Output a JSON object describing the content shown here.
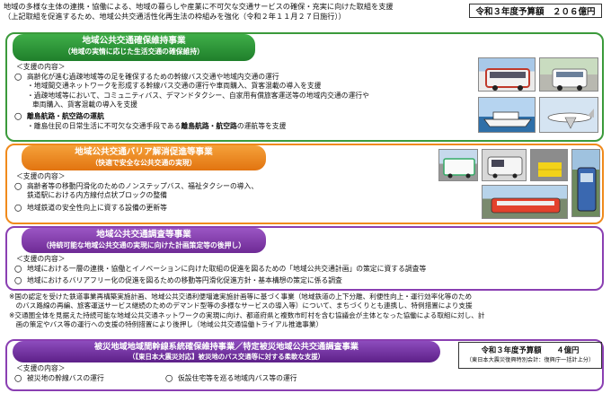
{
  "intro": [
    "地域の多様な主体の連携・協働による、地域の暮らしや産業に不可欠な交通サービスの確保・充実に向けた取組を支援",
    "（上記取組を促進するため、地域公共交通活性化再生法の枠組みを強化（令和２年１１月２７日施行））"
  ],
  "budget": "令和３年度予算額　２０６億円",
  "sections": {
    "s1": {
      "title": "地域公共交通確保維持事業",
      "subtitle": "（地域の実情に応じた生活交通の確保維持）",
      "support_label": "＜支援の内容＞",
      "bullet1": "高齢化が進む過疎地域等の足を確保するための幹線バス交通や地域内交通の運行",
      "sub1": "・地域間交通ネットワークを形成する幹線バス交通の運行や車両購入、貨客混載の導入を支援",
      "sub2": "・過疎地域等において、コミュニティバス、デマンドタクシー、自家用有償旅客運送等の地域内交通の運行や",
      "sub2b": "車両購入、貨客混載の導入を支援",
      "bullet2": "離島航路・航空路の運航",
      "sub3_pre": "・離島住民の日常生活に不可欠な交通手段である",
      "sub3_bold": "離島航路・航空路",
      "sub3_post": "の運航等を支援"
    },
    "s2": {
      "title": "地域公共交通バリア解消促進等事業",
      "subtitle": "（快適で安全な公共交通の実現）",
      "support_label": "＜支援の内容＞",
      "bullet1": "高齢者等の移動円滑化のためのノンステップバス、福祉タクシーの導入、",
      "bullet1b": "鉄道駅における内方線付点状ブロックの整備",
      "bullet2": "地域鉄道の安全性向上に資する設備の更新等"
    },
    "s3": {
      "title": "地域公共交通調査等事業",
      "subtitle": "（持続可能な地域公共交通の実現に向けた計画策定等の後押し）",
      "support_label": "＜支援の内容＞",
      "bullet1": "地域における一層の連携・協働とイノベーションに向けた取組の促進を図るための「地域公共交通計画」の策定に資する調査等",
      "bullet2": "地域におけるバリアフリー化の促進を図るための移動等円滑化促進方針・基本構想の策定に係る調査"
    }
  },
  "notes": [
    "※国の認定を受けた鉄道事業再構築実施計画、地域公共交通利便増進実施計画等に基づく事業（地域鉄道の上下分離、利便性向上・運行効率化等のため",
    "　のバス路線の再編、旅客運送サービス継続のためのデマンド型等の多様なサービスの導入等）について、まちづくりとも連携し、特例措置により支援",
    "※交通圏全体を見据えた持続可能な地域公共交通ネットワークの実現に向け、都道府県と複数市町村を含む協議会が主体となった協働による取組に対し、計",
    "　画の策定やバス等の運行への支援の特例措置により後押し（地域公共交通協働トライアル推進事業）"
  ],
  "bottom": {
    "title": "被災地域地域間幹線系統確保維持事業／特定被災地域公共交通調査事業",
    "subtitle": "（【東日本大震災対応】被災地のバス交通等に対する柔軟な支援）",
    "support_label": "＜支援の内容＞",
    "item1": "被災地の幹線バスの運行",
    "item2": "仮設住宅等を巡る地域内バス等の運行",
    "budget": "令和３年度予算額　　４億円",
    "budget_note": "（東日本大震災復興特別会計：復興庁一括計上分）"
  },
  "icons": [
    "bus-photo-icon",
    "demand-taxi-photo-icon",
    "ferry-photo-icon",
    "airplane-photo-icon",
    "nonstep-bus-photo-icon",
    "welfare-taxi-photo-icon",
    "tactile-block-photo-icon",
    "local-railway-photo-icon"
  ],
  "colors": {
    "green": "#3b9a3b",
    "orange": "#f08a1c",
    "purple": "#8a3fb2"
  }
}
